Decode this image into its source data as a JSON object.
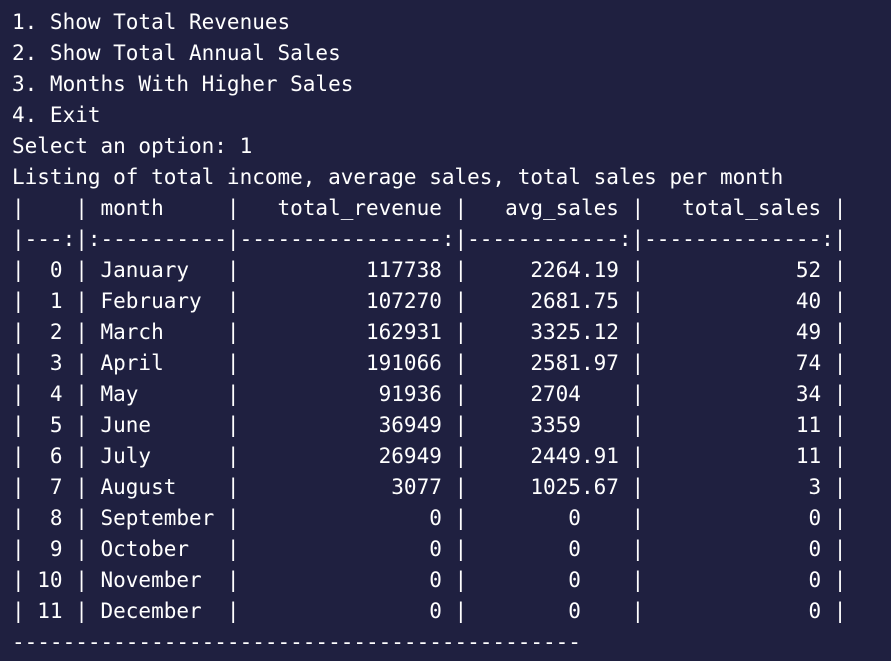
{
  "menu": {
    "items": [
      "1. Show Total Revenues",
      "2. Show Total Annual Sales",
      "3. Months With Higher Sales",
      "4. Exit"
    ]
  },
  "prompt": {
    "label": "Select an option: ",
    "value": "1"
  },
  "caption": "Listing of total income, average sales, total sales per month",
  "table": {
    "header_line": "|    | month     |   total_revenue |   avg_sales |   total_sales |",
    "separator_line": "|---:|:----------|----------------:|------------:|--------------:|",
    "rows": [
      "|  0 | January   |          117738 |     2264.19 |            52 |",
      "|  1 | February  |          107270 |     2681.75 |            40 |",
      "|  2 | March     |          162931 |     3325.12 |            49 |",
      "|  3 | April     |          191066 |     2581.97 |            74 |",
      "|  4 | May       |           91936 |     2704    |            34 |",
      "|  5 | June      |           36949 |     3359    |            11 |",
      "|  6 | July      |           26949 |     2449.91 |            11 |",
      "|  7 | August    |            3077 |     1025.67 |             3 |",
      "|  8 | September |               0 |        0    |             0 |",
      "|  9 | October   |               0 |        0    |             0 |",
      "| 10 | November  |               0 |        0    |             0 |",
      "| 11 | December  |               0 |        0    |             0 |"
    ]
  },
  "footer_rule": "---------------------------------------------"
}
